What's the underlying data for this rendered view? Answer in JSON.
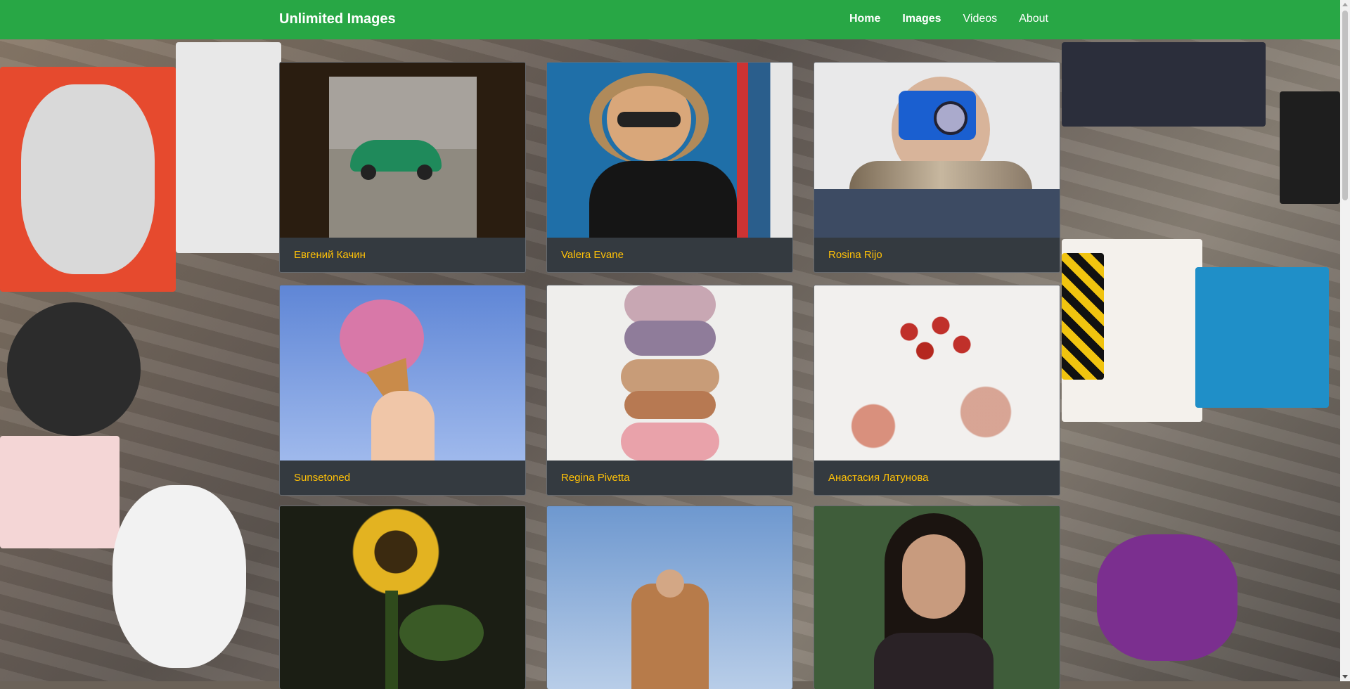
{
  "navbar": {
    "brand": "Unlimited Images",
    "links": [
      {
        "label": "Home",
        "bold": true
      },
      {
        "label": "Images",
        "bold": true
      },
      {
        "label": "Videos",
        "bold": false
      },
      {
        "label": "About",
        "bold": false
      }
    ]
  },
  "cards": [
    {
      "caption": "Евгений Качин",
      "image_icon": "green-car-photo"
    },
    {
      "caption": "Valera Evane",
      "image_icon": "woman-sunglasses-photo"
    },
    {
      "caption": "Rosina Rijo",
      "image_icon": "camera-woman-photo"
    },
    {
      "caption": "Sunsetoned",
      "image_icon": "flower-cone-photo"
    },
    {
      "caption": "Regina Pivetta",
      "image_icon": "macarons-photo"
    },
    {
      "caption": "Анастасия Латунова",
      "image_icon": "red-berries-photo"
    },
    {
      "caption": "",
      "image_icon": "sunflower-photo"
    },
    {
      "caption": "",
      "image_icon": "man-shirt-photo"
    },
    {
      "caption": "",
      "image_icon": "woman-portrait-photo"
    }
  ],
  "colors": {
    "navbar": "#28a745",
    "card_bg": "#343a40",
    "caption": "#ffc107"
  }
}
